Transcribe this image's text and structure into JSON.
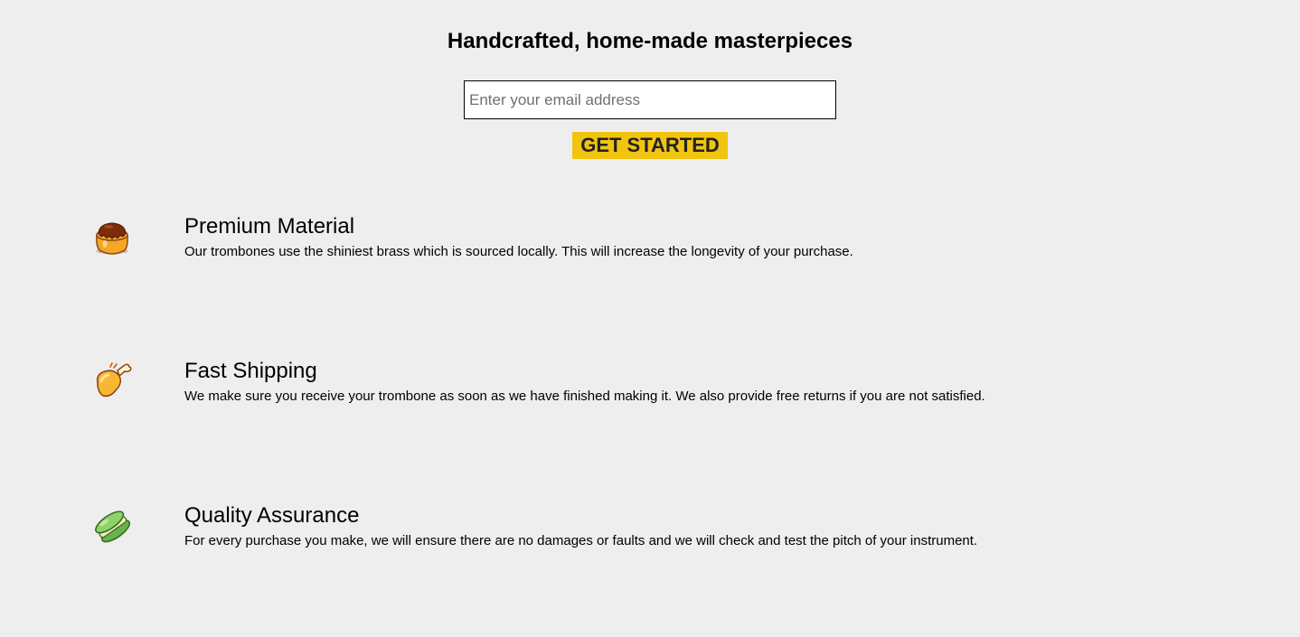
{
  "hero": {
    "title": "Handcrafted, home-made masterpieces",
    "email_placeholder": "Enter your email address",
    "email_value": "",
    "button_label": "GET STARTED",
    "button_color": "#f1c40f"
  },
  "features": [
    {
      "icon": "pudding-icon",
      "title": "Premium Material",
      "description": "Our trombones use the shiniest brass which is sourced locally. This will increase the longevity of your purchase."
    },
    {
      "icon": "chicken-leg-icon",
      "title": "Fast Shipping",
      "description": "We make sure you receive your trombone as soon as we have finished making it. We also provide free returns if you are not satisfied."
    },
    {
      "icon": "macaron-icon",
      "title": "Quality Assurance",
      "description": "For every purchase you make, we will ensure there are no damages or faults and we will check and test the pitch of your instrument."
    }
  ]
}
